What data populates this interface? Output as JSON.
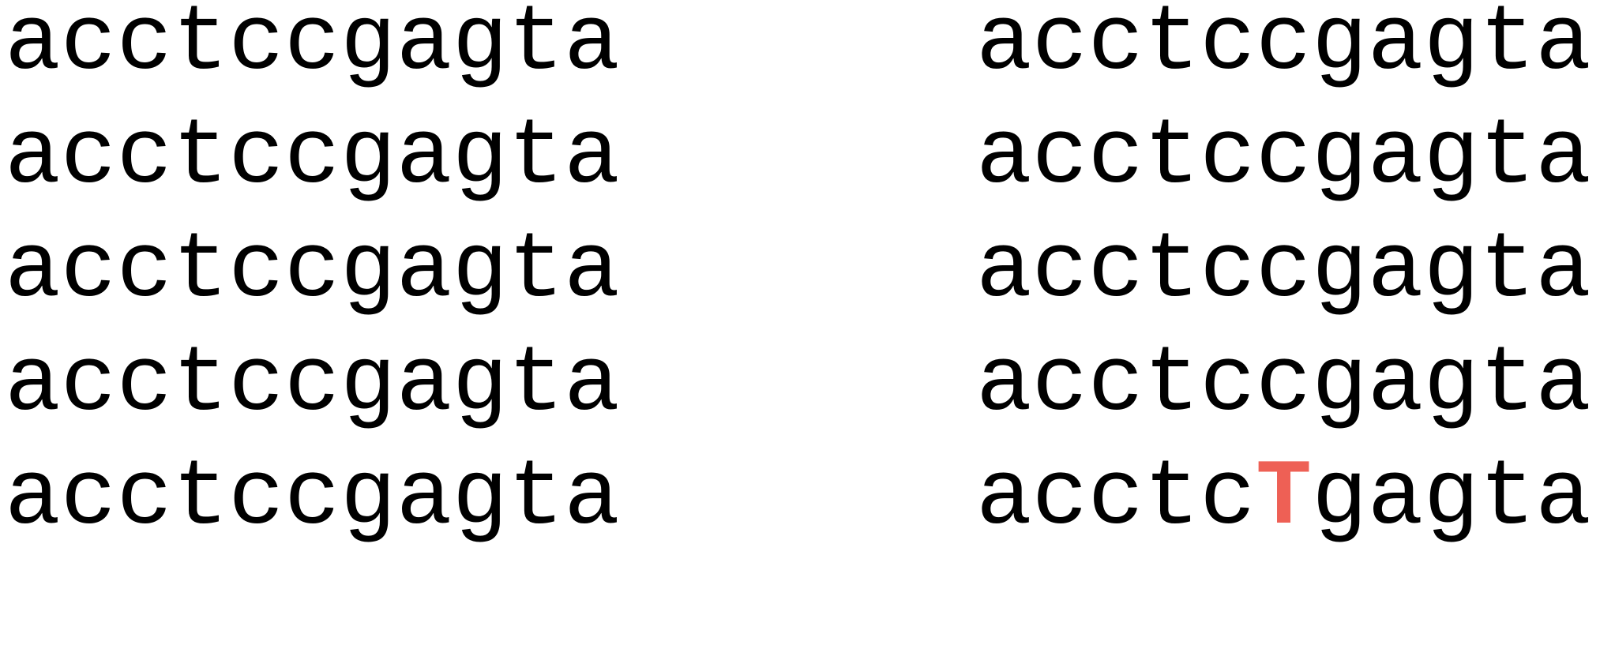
{
  "left_column": {
    "sequences": [
      "acctccgagta",
      "acctccgagta",
      "acctccgagta",
      "acctccgagta",
      "acctccgagta"
    ]
  },
  "right_column": {
    "sequences": [
      "acctccgagta",
      "acctccgagta",
      "acctccgagta",
      "acctccgagta"
    ],
    "mutated_sequence": {
      "prefix": "acctc",
      "mutation": "T",
      "suffix": "gagta",
      "mutation_color": "#ee6055"
    }
  }
}
